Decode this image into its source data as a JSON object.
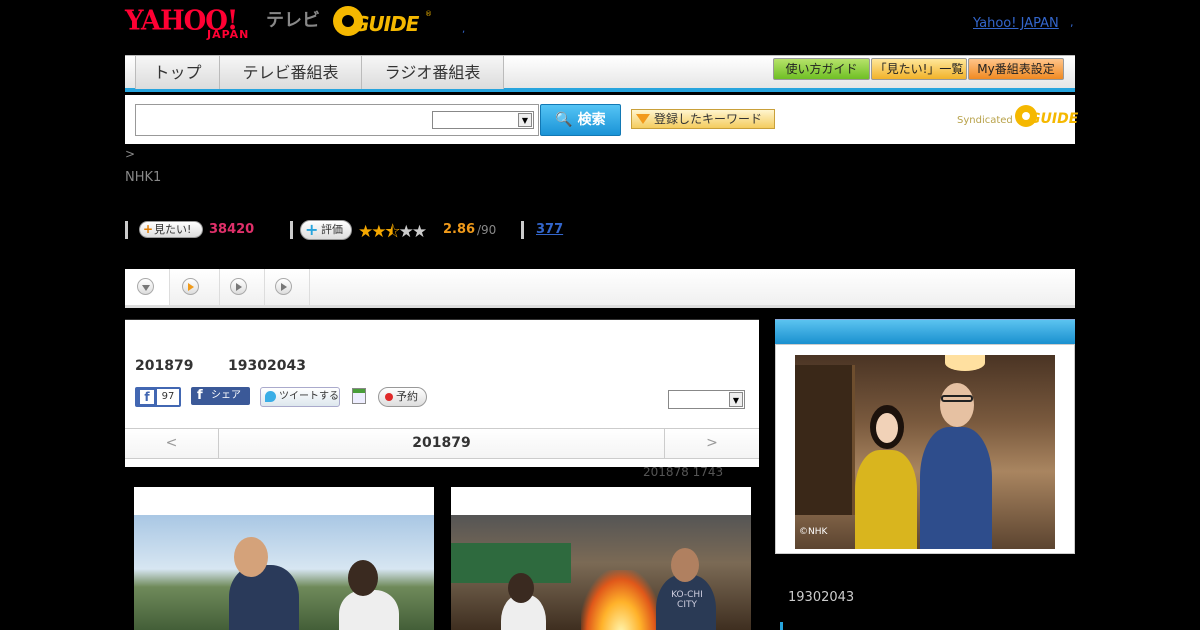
{
  "header": {
    "logo_yahoo_top": "YAHOO!",
    "logo_yahoo_bottom": "JAPAN",
    "logo_tv": "テレビ",
    "logo_gguide": "GUIDE",
    "logo_gguide_reg": "®",
    "small_dot": ",",
    "yahoo_japan_link": "Yahoo! JAPAN",
    "link_dot": ","
  },
  "nav": {
    "tabs": [
      {
        "label": "トップ"
      },
      {
        "label": "テレビ番組表"
      },
      {
        "label": "ラジオ番組表"
      }
    ],
    "buttons": [
      {
        "label": "使い方ガイド",
        "color": "#6fbf24"
      },
      {
        "label": "「見たい!」一覧",
        "color": "#f1b22a"
      },
      {
        "label": "My番組表設定",
        "color": "#f08a22"
      }
    ]
  },
  "search": {
    "input_value": "",
    "select_value": "",
    "button_label": "検索",
    "keyword_button": "登録したキーワード",
    "syndicated": "Syndicated",
    "syndicated_logo": "GUIDE"
  },
  "breadcrumb": ">",
  "channel": "NHK1",
  "stats": {
    "mitai_label": "見たい!",
    "mitai_count": "38420",
    "hyoka_label": "評価",
    "rating_stars": 2.5,
    "rating_value": "2.86",
    "rating_max": "/90",
    "review_count": "377"
  },
  "tabbar": {
    "tab2_dot": "."
  },
  "program": {
    "date": "201879",
    "time": "19302043",
    "fb_like_count": "97",
    "fb_share_label": "シェア",
    "tweet_label": "ツイートする",
    "reserve_label": "予約",
    "select_value": "",
    "date_prev": "<",
    "date_current": "201879",
    "date_next": ">",
    "rebroadcast": "201878  1743"
  },
  "thumbnails": {
    "t2_shirt_text": "KO-CHI CITY"
  },
  "sidebar": {
    "image_credit": "©NHK",
    "time": "19302043"
  },
  "colors": {
    "accent_blue": "#27a4dd",
    "rating_orange": "#f09a1a",
    "mitai_pink": "#e0306a",
    "link_blue": "#3366cc"
  }
}
